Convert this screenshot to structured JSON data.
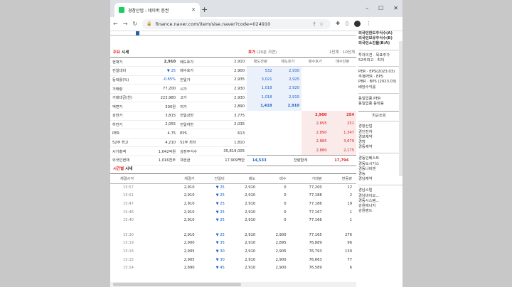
{
  "browser": {
    "tab_title": "경창산업 : 네이버 증권",
    "new_tab": "+",
    "minimize": "–",
    "maximize": "☐",
    "close": "✕",
    "url": "finance.naver.com/item/sise.naver?code=024910"
  },
  "summary": {
    "title_hl": "주요",
    "title": "시세",
    "rows": [
      [
        "현재가",
        "2,910",
        "매도호가",
        "2,910"
      ],
      [
        "전일대비",
        "▼ 25",
        "매수호가",
        "2,900"
      ],
      [
        "등락률(%)",
        "-0.85%",
        "전일가",
        "2,935"
      ],
      [
        "거래량",
        "77,200",
        "시가",
        "2,930"
      ],
      [
        "거래대금(천)",
        "223,980",
        "고가",
        "2,930"
      ],
      [
        "액면가",
        "500원",
        "저가",
        "2,890"
      ],
      [
        "상한가",
        "3,815",
        "전일상한",
        "3,775"
      ],
      [
        "하한가",
        "2,055",
        "전일하한",
        "2,035"
      ],
      [
        "PER",
        "4.75",
        "EPS",
        "613"
      ],
      [
        "52주 최고",
        "4,210",
        "52주 최저",
        "1,810"
      ],
      [
        "시가총액",
        "1,042억원",
        "상장주식수",
        "35,819,005"
      ],
      [
        "외국인현재",
        "1,016천주",
        "자본금",
        "17,909백만"
      ]
    ]
  },
  "orderbook": {
    "title": "호가",
    "subtitle": "(20분 지연)",
    "prev_link": "1단계",
    "next_link": "10단계",
    "headers": [
      "매도잔량",
      "매도호가",
      "매수호가",
      "매수잔량"
    ],
    "asks": [
      [
        "532",
        "2,930"
      ],
      [
        "3,021",
        "2,925"
      ],
      [
        "1,018",
        "2,920"
      ],
      [
        "1,018",
        "2,915"
      ],
      [
        "1,418",
        "2,910"
      ]
    ],
    "bids": [
      [
        "2,900",
        "254"
      ],
      [
        "2,895",
        "251"
      ],
      [
        "2,890",
        "1,347"
      ],
      [
        "2,885",
        "3,679"
      ],
      [
        "2,880",
        "2,175"
      ]
    ],
    "total_ask": "14,533",
    "total_label": "잔량합계",
    "total_bid": "17,794"
  },
  "timed": {
    "title_hl": "시간별",
    "title": "시세",
    "headers": [
      "체결시각",
      "체결가",
      "전일비",
      "매도",
      "매수",
      "거래량",
      "변동량"
    ],
    "rows": [
      [
        "15:57",
        "2,910",
        "▼ 25",
        "2,910",
        "0",
        "77,200",
        "12"
      ],
      [
        "15:51",
        "2,910",
        "▼ 25",
        "2,910",
        "0",
        "77,188",
        "2"
      ],
      [
        "15:47",
        "2,910",
        "▼ 25",
        "2,910",
        "0",
        "77,186",
        "19"
      ],
      [
        "15:46",
        "2,910",
        "▼ 25",
        "2,910",
        "0",
        "77,167",
        "1"
      ],
      [
        "15:40",
        "2,910",
        "▼ 25",
        "2,910",
        "0",
        "77,166",
        "1"
      ],
      [
        "15:30",
        "2,910",
        "▼ 25",
        "2,910",
        "2,900",
        "77,165",
        "276"
      ],
      [
        "15:19",
        "2,900",
        "▼ 35",
        "2,910",
        "2,895",
        "76,889",
        "96"
      ],
      [
        "15:16",
        "2,905",
        "▼ 30",
        "2,910",
        "2,905",
        "76,793",
        "130"
      ],
      [
        "15:15",
        "2,905",
        "▼ 30",
        "2,910",
        "2,900",
        "76,663",
        "77"
      ],
      [
        "15:14",
        "2,890",
        "▼ 45",
        "2,910",
        "2,900",
        "76,589",
        "6"
      ]
    ]
  },
  "side": {
    "lines_top": [
      "외국인한도주식수(A)",
      "외국인보유주식수(B)",
      "외국인소진율(B/A)"
    ],
    "lines_mid": [
      "투자의견 · 목표주가",
      "52주최고 · 최저"
    ],
    "lines_per": [
      "PER · EPS(2023.03)",
      "추정PER · EPS",
      "PBR · BPS (2023.03)",
      "배당수익률"
    ],
    "lines_same": [
      "동일업종 PER",
      "동일업종 등락률"
    ],
    "recent_title": "최근조회",
    "recent": [
      "경창산업",
      "경인전자",
      "경보제약",
      "경방",
      "경동제약"
    ],
    "recent2": [
      "경동인베스트",
      "경동도시가스",
      "경동나비엔",
      "경농",
      "경남제약"
    ],
    "recent3": [
      "경남스틸",
      "경남바이오...",
      "경동시스템...",
      "강원에너지",
      "강원랜드"
    ]
  }
}
